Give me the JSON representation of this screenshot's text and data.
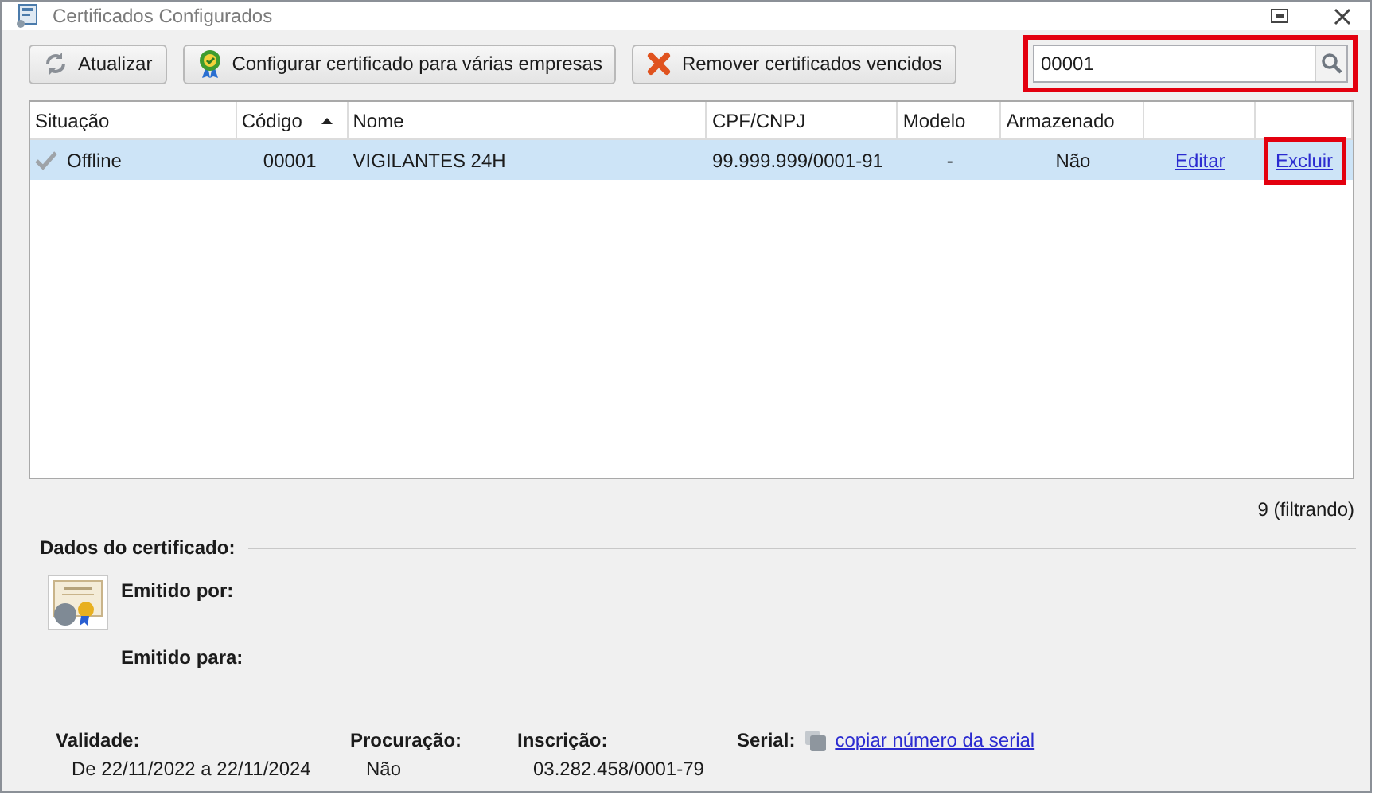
{
  "window": {
    "title": "Certificados Configurados"
  },
  "toolbar": {
    "buttons": [
      {
        "label": "Atualizar",
        "kind": "refresh"
      },
      {
        "label": "Configurar certificado para várias empresas",
        "kind": "badge"
      },
      {
        "label": "Remover certificados vencidos",
        "kind": "remove"
      }
    ],
    "search": {
      "value": "00001",
      "highlighted": true
    }
  },
  "table": {
    "columns": [
      {
        "label": "Situação",
        "sorted": false
      },
      {
        "label": "Código",
        "sorted": true
      },
      {
        "label": "Nome",
        "sorted": false
      },
      {
        "label": "CPF/CNPJ",
        "sorted": false
      },
      {
        "label": "Modelo",
        "sorted": false
      },
      {
        "label": "Armazenado",
        "sorted": false
      }
    ],
    "rows": [
      {
        "selected": true,
        "situacao": "Offline",
        "codigo": "00001",
        "nome": "VIGILANTES 24H",
        "cpf_cnpj": "99.999.999/0001-91",
        "modelo": "-",
        "armazenado": "Não",
        "edit": "Editar",
        "delete": "Excluir",
        "delete_highlighted": true
      }
    ],
    "count": "9 (filtrando)"
  },
  "details": {
    "title": "Dados do certificado:",
    "issued_by": "Emitido por:",
    "issued_to": "Emitido para:",
    "fields": [
      {
        "label": "Validade:",
        "value": "De 22/11/2022 a 22/11/2024"
      },
      {
        "label": "Procuração:",
        "value": "Não"
      },
      {
        "label": "Inscrição:",
        "value": "03.282.458/0001-79"
      }
    ],
    "serial": {
      "label": "Serial:",
      "link": "copiar número da serial"
    }
  }
}
